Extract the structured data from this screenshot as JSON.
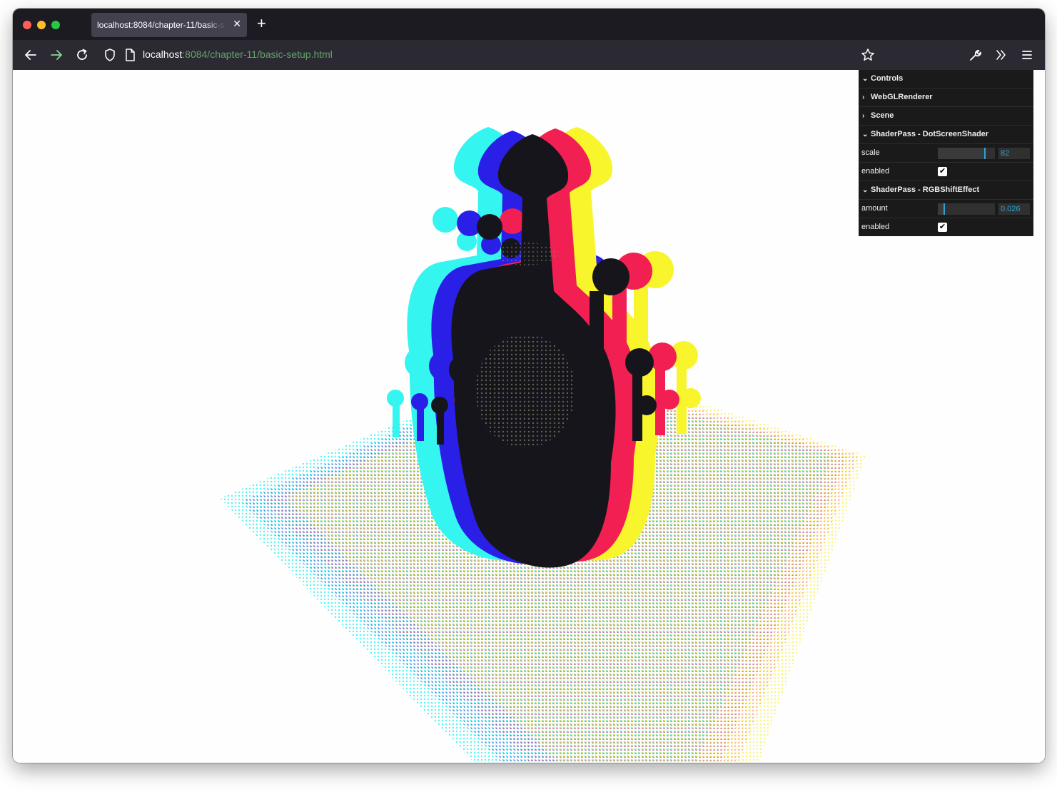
{
  "browser": {
    "tab_title": "localhost:8084/chapter-11/basic-setup.html",
    "tab_close_icon": "close-icon",
    "new_tab_icon": "plus-icon",
    "url_host": "localhost",
    "url_path": ":8084/chapter-11/basic-setup.html"
  },
  "gui": {
    "folders": {
      "controls": "Controls",
      "renderer": "WebGLRenderer",
      "scene": "Scene",
      "dot_screen": "ShaderPass - DotScreenShader",
      "rgb_shift": "ShaderPass - RGBShiftEffect"
    },
    "dot_screen": {
      "scale_label": "scale",
      "scale_value": "82",
      "scale_fraction": 0.82,
      "enabled_label": "enabled",
      "enabled": true
    },
    "rgb_shift": {
      "amount_label": "amount",
      "amount_value": "0.026",
      "amount_fraction": 0.1,
      "enabled_label": "enabled",
      "enabled": true
    }
  },
  "colors": {
    "cyan": "#35f5f0",
    "blue": "#2a1fe6",
    "red": "#f21f52",
    "yellow": "#f8f52c",
    "dark": "#17151c",
    "gui_accent": "#2fa1d6"
  }
}
